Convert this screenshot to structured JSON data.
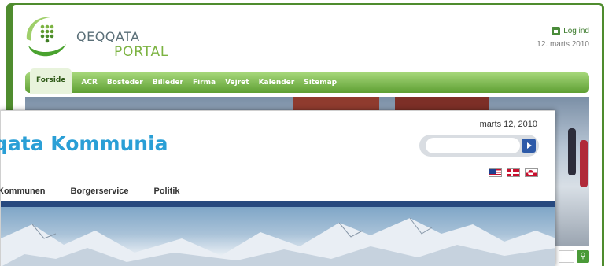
{
  "portal": {
    "logo_line1": "QEQQATA",
    "logo_line2": "PORTAL",
    "login_label": "Log ind",
    "date": "12. marts 2010",
    "nav": [
      {
        "label": "Forside",
        "active": true
      },
      {
        "label": "ACR"
      },
      {
        "label": "Bosteder"
      },
      {
        "label": "Billeder"
      },
      {
        "label": "Firma"
      },
      {
        "label": "Vejret"
      },
      {
        "label": "Kalender"
      },
      {
        "label": "Sitemap"
      }
    ],
    "accent_color": "#5e9f33",
    "search_icon": "magnifier-icon"
  },
  "kommunia": {
    "date": "marts 12, 2010",
    "title": "qata Kommunia",
    "search_placeholder": "",
    "search_button_icon": "arrow-right-icon",
    "flags": [
      "flag-usa-icon",
      "flag-denmark-icon",
      "flag-greenland-icon"
    ],
    "nav": [
      {
        "label": "Kommunen"
      },
      {
        "label": "Borgerservice"
      },
      {
        "label": "Politik"
      }
    ],
    "title_color": "#2a9fd6",
    "bar_color": "#27497f"
  }
}
